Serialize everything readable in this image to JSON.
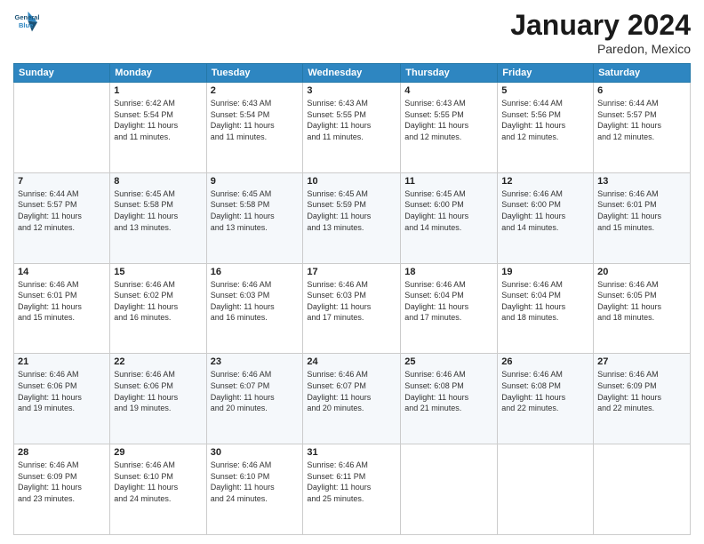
{
  "logo": {
    "line1": "General",
    "line2": "Blue"
  },
  "title": "January 2024",
  "subtitle": "Paredon, Mexico",
  "header_days": [
    "Sunday",
    "Monday",
    "Tuesday",
    "Wednesday",
    "Thursday",
    "Friday",
    "Saturday"
  ],
  "weeks": [
    [
      {
        "num": "",
        "info": ""
      },
      {
        "num": "1",
        "info": "Sunrise: 6:42 AM\nSunset: 5:54 PM\nDaylight: 11 hours\nand 11 minutes."
      },
      {
        "num": "2",
        "info": "Sunrise: 6:43 AM\nSunset: 5:54 PM\nDaylight: 11 hours\nand 11 minutes."
      },
      {
        "num": "3",
        "info": "Sunrise: 6:43 AM\nSunset: 5:55 PM\nDaylight: 11 hours\nand 11 minutes."
      },
      {
        "num": "4",
        "info": "Sunrise: 6:43 AM\nSunset: 5:55 PM\nDaylight: 11 hours\nand 12 minutes."
      },
      {
        "num": "5",
        "info": "Sunrise: 6:44 AM\nSunset: 5:56 PM\nDaylight: 11 hours\nand 12 minutes."
      },
      {
        "num": "6",
        "info": "Sunrise: 6:44 AM\nSunset: 5:57 PM\nDaylight: 11 hours\nand 12 minutes."
      }
    ],
    [
      {
        "num": "7",
        "info": "Sunrise: 6:44 AM\nSunset: 5:57 PM\nDaylight: 11 hours\nand 12 minutes."
      },
      {
        "num": "8",
        "info": "Sunrise: 6:45 AM\nSunset: 5:58 PM\nDaylight: 11 hours\nand 13 minutes."
      },
      {
        "num": "9",
        "info": "Sunrise: 6:45 AM\nSunset: 5:58 PM\nDaylight: 11 hours\nand 13 minutes."
      },
      {
        "num": "10",
        "info": "Sunrise: 6:45 AM\nSunset: 5:59 PM\nDaylight: 11 hours\nand 13 minutes."
      },
      {
        "num": "11",
        "info": "Sunrise: 6:45 AM\nSunset: 6:00 PM\nDaylight: 11 hours\nand 14 minutes."
      },
      {
        "num": "12",
        "info": "Sunrise: 6:46 AM\nSunset: 6:00 PM\nDaylight: 11 hours\nand 14 minutes."
      },
      {
        "num": "13",
        "info": "Sunrise: 6:46 AM\nSunset: 6:01 PM\nDaylight: 11 hours\nand 15 minutes."
      }
    ],
    [
      {
        "num": "14",
        "info": "Sunrise: 6:46 AM\nSunset: 6:01 PM\nDaylight: 11 hours\nand 15 minutes."
      },
      {
        "num": "15",
        "info": "Sunrise: 6:46 AM\nSunset: 6:02 PM\nDaylight: 11 hours\nand 16 minutes."
      },
      {
        "num": "16",
        "info": "Sunrise: 6:46 AM\nSunset: 6:03 PM\nDaylight: 11 hours\nand 16 minutes."
      },
      {
        "num": "17",
        "info": "Sunrise: 6:46 AM\nSunset: 6:03 PM\nDaylight: 11 hours\nand 17 minutes."
      },
      {
        "num": "18",
        "info": "Sunrise: 6:46 AM\nSunset: 6:04 PM\nDaylight: 11 hours\nand 17 minutes."
      },
      {
        "num": "19",
        "info": "Sunrise: 6:46 AM\nSunset: 6:04 PM\nDaylight: 11 hours\nand 18 minutes."
      },
      {
        "num": "20",
        "info": "Sunrise: 6:46 AM\nSunset: 6:05 PM\nDaylight: 11 hours\nand 18 minutes."
      }
    ],
    [
      {
        "num": "21",
        "info": "Sunrise: 6:46 AM\nSunset: 6:06 PM\nDaylight: 11 hours\nand 19 minutes."
      },
      {
        "num": "22",
        "info": "Sunrise: 6:46 AM\nSunset: 6:06 PM\nDaylight: 11 hours\nand 19 minutes."
      },
      {
        "num": "23",
        "info": "Sunrise: 6:46 AM\nSunset: 6:07 PM\nDaylight: 11 hours\nand 20 minutes."
      },
      {
        "num": "24",
        "info": "Sunrise: 6:46 AM\nSunset: 6:07 PM\nDaylight: 11 hours\nand 20 minutes."
      },
      {
        "num": "25",
        "info": "Sunrise: 6:46 AM\nSunset: 6:08 PM\nDaylight: 11 hours\nand 21 minutes."
      },
      {
        "num": "26",
        "info": "Sunrise: 6:46 AM\nSunset: 6:08 PM\nDaylight: 11 hours\nand 22 minutes."
      },
      {
        "num": "27",
        "info": "Sunrise: 6:46 AM\nSunset: 6:09 PM\nDaylight: 11 hours\nand 22 minutes."
      }
    ],
    [
      {
        "num": "28",
        "info": "Sunrise: 6:46 AM\nSunset: 6:09 PM\nDaylight: 11 hours\nand 23 minutes."
      },
      {
        "num": "29",
        "info": "Sunrise: 6:46 AM\nSunset: 6:10 PM\nDaylight: 11 hours\nand 24 minutes."
      },
      {
        "num": "30",
        "info": "Sunrise: 6:46 AM\nSunset: 6:10 PM\nDaylight: 11 hours\nand 24 minutes."
      },
      {
        "num": "31",
        "info": "Sunrise: 6:46 AM\nSunset: 6:11 PM\nDaylight: 11 hours\nand 25 minutes."
      },
      {
        "num": "",
        "info": ""
      },
      {
        "num": "",
        "info": ""
      },
      {
        "num": "",
        "info": ""
      }
    ]
  ]
}
